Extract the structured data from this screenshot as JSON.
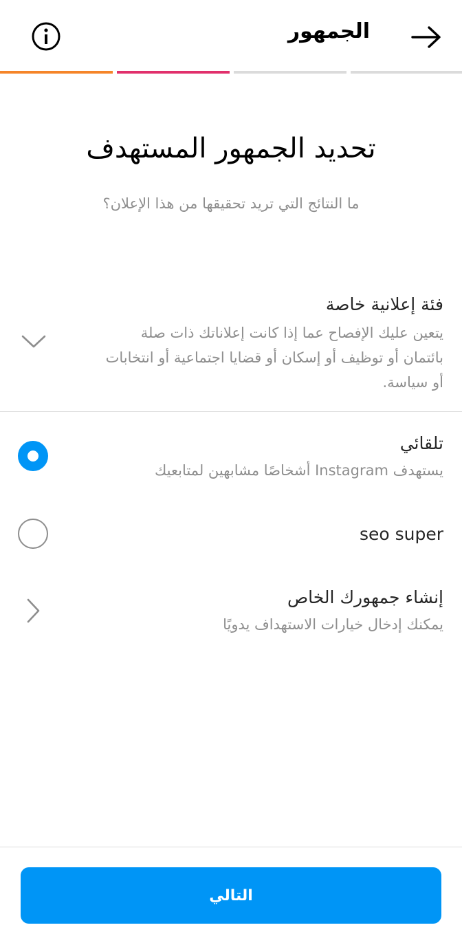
{
  "header": {
    "title": "الجمهور",
    "info_icon": "info-icon",
    "back_icon": "arrow-right-icon"
  },
  "progress": {
    "colors": [
      "#f58529",
      "#e1306c",
      "#dbdbdb",
      "#dbdbdb"
    ],
    "current_step": 2,
    "total_steps": 4
  },
  "main": {
    "title": "تحديد الجمهور المستهدف",
    "subtitle": "ما النتائج التي تريد تحقيقها من هذا الإعلان؟"
  },
  "special_category": {
    "title": "فئة إعلانية خاصة",
    "description": "يتعين عليك الإفصاح عما إذا كانت إعلاناتك ذات صلة بائتمان أو توظيف أو إسكان أو قضايا اجتماعية أو انتخابات أو سياسة.",
    "icon": "chevron-down-icon"
  },
  "options": [
    {
      "title": "تلقائي",
      "subtitle": "يستهدف Instagram أشخاصًا مشابهين لمتابعيك",
      "selected": true
    },
    {
      "title": "seo super",
      "subtitle": "",
      "selected": false
    },
    {
      "title": "إنشاء جمهورك الخاص",
      "subtitle": "يمكنك إدخال خيارات الاستهداف يدويًا",
      "icon": "chevron-right-icon"
    }
  ],
  "footer": {
    "next_label": "التالي"
  },
  "colors": {
    "accent": "#0095f6",
    "text_primary": "#262626",
    "text_secondary": "#8e8e8e",
    "divider": "#dbdbdb"
  }
}
